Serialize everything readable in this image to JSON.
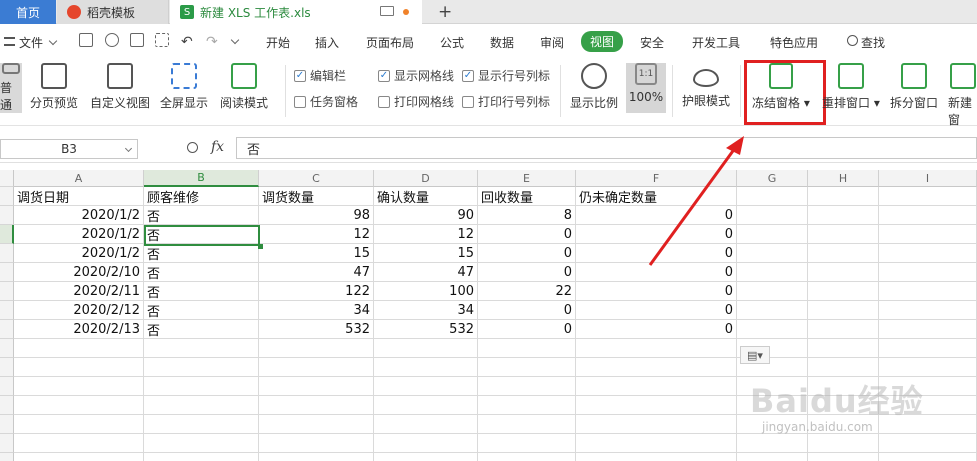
{
  "tabs": {
    "home": "首页",
    "template": "稻壳模板",
    "file": "新建 XLS 工作表.xls",
    "new_tab": "+"
  },
  "menu": {
    "file": "文件",
    "items": [
      "开始",
      "插入",
      "页面布局",
      "公式",
      "数据",
      "审阅",
      "视图",
      "安全",
      "开发工具",
      "特色应用"
    ],
    "active": "视图",
    "search": "查找"
  },
  "ribbon": {
    "normal": "普通",
    "page_break": "分页预览",
    "custom_view": "自定义视图",
    "fullscreen": "全屏显示",
    "reading_mode": "阅读模式",
    "checks": [
      {
        "label": "编辑栏",
        "checked": true
      },
      {
        "label": "任务窗格",
        "checked": false
      },
      {
        "label": "显示网格线",
        "checked": true
      },
      {
        "label": "打印网格线",
        "checked": false
      },
      {
        "label": "显示行号列标",
        "checked": true
      },
      {
        "label": "打印行号列标",
        "checked": false
      }
    ],
    "zoom": "显示比例",
    "zoom_pct": "100%",
    "zoom_icon_text": "1:1",
    "eye_mode": "护眼模式",
    "freeze": "冻结窗格",
    "rearrange": "重排窗口",
    "split": "拆分窗口",
    "new_window": "新建窗"
  },
  "formula": {
    "cell_ref": "B3",
    "fx": "fx",
    "content": "否"
  },
  "columns": [
    "A",
    "B",
    "C",
    "D",
    "E",
    "F",
    "G",
    "H",
    "I"
  ],
  "header_row": [
    "调货日期",
    "顾客维修",
    "调货数量",
    "确认数量",
    "回收数量",
    "仍未确定数量"
  ],
  "rows": [
    [
      "2020/1/2",
      "否",
      "98",
      "90",
      "8",
      "0"
    ],
    [
      "2020/1/2",
      "否",
      "12",
      "12",
      "0",
      "0"
    ],
    [
      "2020/1/2",
      "否",
      "15",
      "15",
      "0",
      "0"
    ],
    [
      "2020/2/10",
      "否",
      "47",
      "47",
      "0",
      "0"
    ],
    [
      "2020/2/11",
      "否",
      "122",
      "100",
      "22",
      "0"
    ],
    [
      "2020/2/12",
      "否",
      "34",
      "34",
      "0",
      "0"
    ],
    [
      "2020/2/13",
      "否",
      "532",
      "532",
      "0",
      "0"
    ]
  ],
  "watermark": {
    "brand": "Baidu经验",
    "url": "jingyan.baidu.com"
  },
  "colors": {
    "accent_green": "#36a048",
    "highlight_red": "#e02020",
    "home_tab_blue": "#3b7cd3"
  }
}
